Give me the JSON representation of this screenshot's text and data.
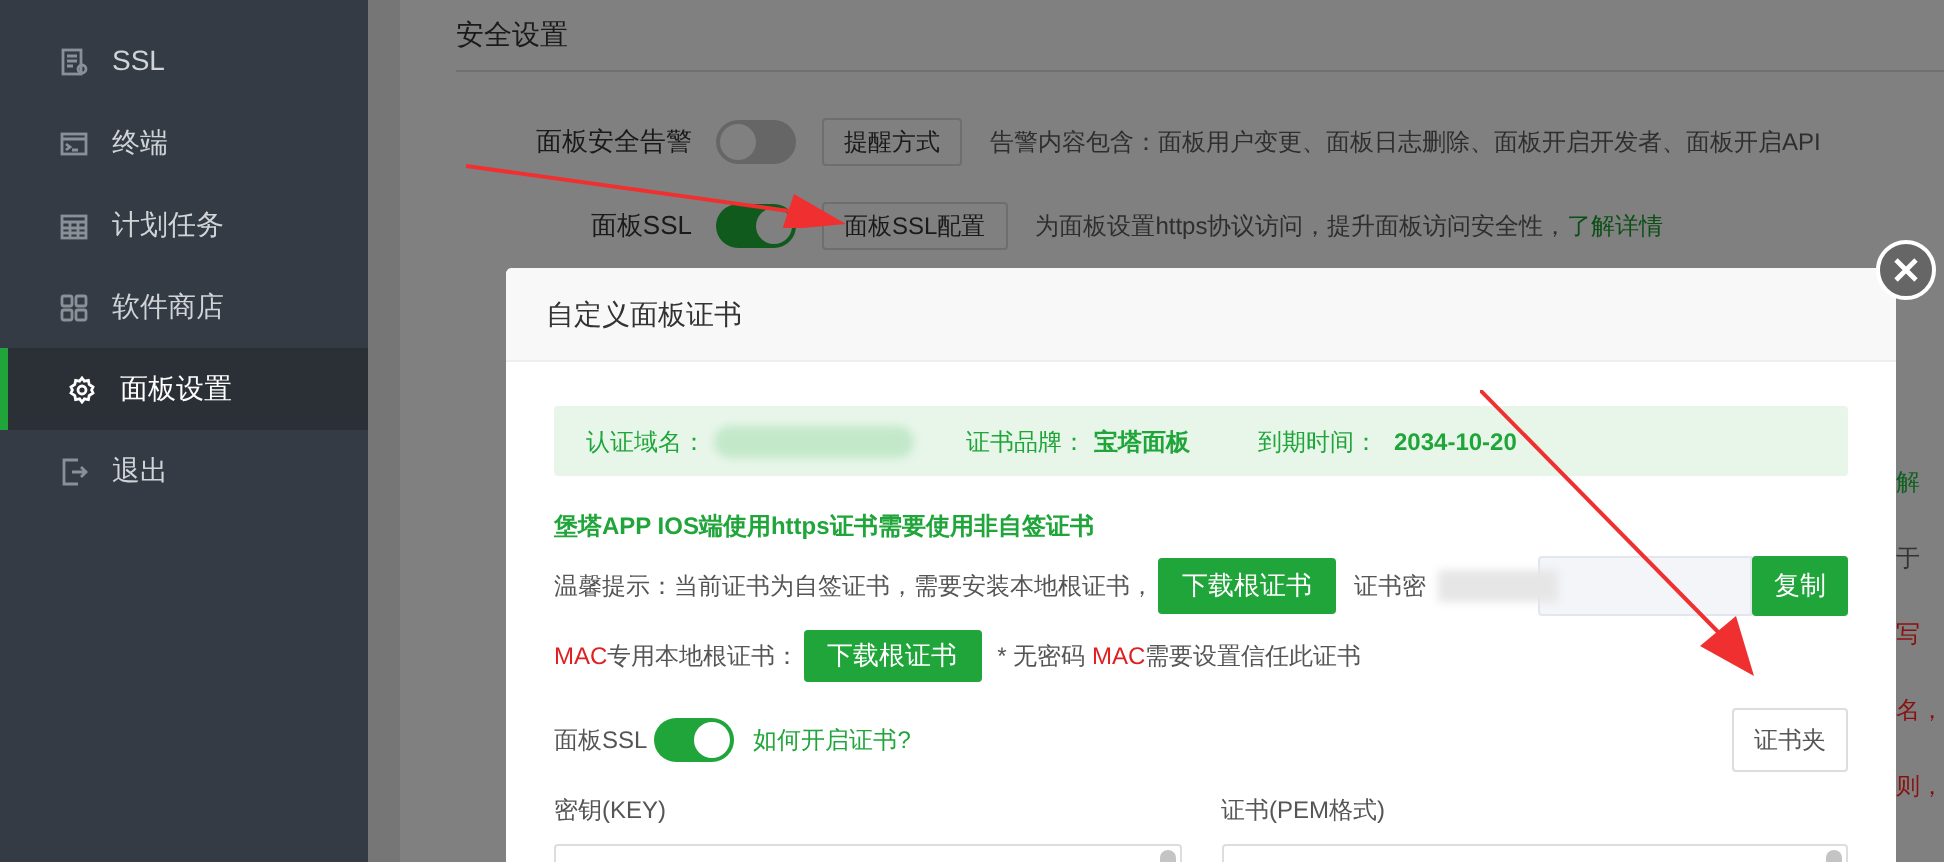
{
  "sidebar": {
    "items": [
      {
        "label": "SSL",
        "selected": false
      },
      {
        "label": "终端",
        "selected": false
      },
      {
        "label": "计划任务",
        "selected": false
      },
      {
        "label": "软件商店",
        "selected": false
      },
      {
        "label": "面板设置",
        "selected": true
      },
      {
        "label": "退出",
        "selected": false
      }
    ]
  },
  "settings": {
    "title": "安全设置",
    "rows": [
      {
        "label": "面板安全告警",
        "on": false,
        "button": "提醒方式",
        "description": "告警内容包含：面板用户变更、面板日志删除、面板开启开发者、面板开启API"
      },
      {
        "label": "面板SSL",
        "on": true,
        "button": "面板SSL配置",
        "description": "为面板设置https协议访问，提升面板访问安全性，",
        "link": "了解详情"
      }
    ],
    "edge_fragments": [
      {
        "text": "解",
        "kind": "link"
      },
      {
        "text": "于",
        "kind": "plain"
      },
      {
        "text": "写",
        "kind": "warning"
      },
      {
        "text": "名，",
        "kind": "warning"
      },
      {
        "text": "则，",
        "kind": "warning"
      }
    ]
  },
  "dialog": {
    "title": "自定义面板证书",
    "info": {
      "domain_label": "认证域名：",
      "brand_label": "证书品牌：",
      "brand": "宝塔面板",
      "expiry_label": "到期时间：",
      "expiry": "2034-10-20"
    },
    "app_notice": "堡塔APP IOS端使用https证书需要使用非自签证书",
    "tip": "温馨提示：当前证书为自签证书，需要安装本地根证书，",
    "download_button": "下载根证书",
    "password_label": "证书密",
    "copy_button": "复制",
    "mac_label": "**MAC**专用本地根证书：",
    "mac_button": "下载根证书",
    "mac_note": "* 无密码 **MAC**需要设置信任此证书",
    "ssl_label": "面板SSL",
    "ssl_on": true,
    "ssl_link": "如何开启证书?",
    "cert_folder_button": "证书夹",
    "key_label": "密钥(KEY)",
    "cert_label": "证书(PEM格式)"
  }
}
